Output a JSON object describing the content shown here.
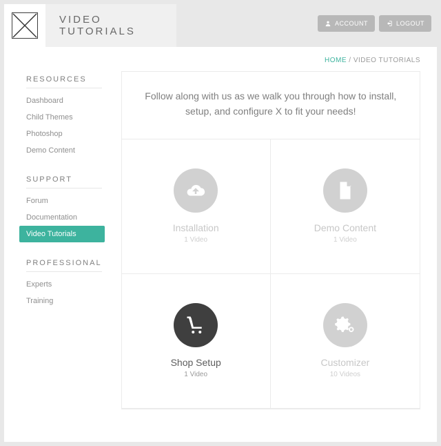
{
  "header": {
    "title": "VIDEO TUTORIALS",
    "account_label": "ACCOUNT",
    "logout_label": "LOGOUT"
  },
  "breadcrumb": {
    "home": "HOME",
    "separator": " / ",
    "current": "VIDEO TUTORIALS"
  },
  "sidebar": {
    "sections": [
      {
        "heading": "RESOURCES",
        "items": [
          {
            "label": "Dashboard"
          },
          {
            "label": "Child Themes"
          },
          {
            "label": "Photoshop"
          },
          {
            "label": "Demo Content"
          }
        ]
      },
      {
        "heading": "SUPPORT",
        "items": [
          {
            "label": "Forum"
          },
          {
            "label": "Documentation"
          },
          {
            "label": "Video Tutorials",
            "active": true
          }
        ]
      },
      {
        "heading": "PROFESSIONAL",
        "items": [
          {
            "label": "Experts"
          },
          {
            "label": "Training"
          }
        ]
      }
    ]
  },
  "main": {
    "intro": "Follow along with us as we walk you through how to install, setup, and configure X to fit your needs!",
    "tiles": [
      {
        "title": "Installation",
        "count": "1 Video",
        "icon": "cloud-upload",
        "emphasis": "muted"
      },
      {
        "title": "Demo Content",
        "count": "1 Video",
        "icon": "file",
        "emphasis": "muted"
      },
      {
        "title": "Shop Setup",
        "count": "1 Video",
        "icon": "cart",
        "emphasis": "dark"
      },
      {
        "title": "Customizer",
        "count": "10 Videos",
        "icon": "gears",
        "emphasis": "muted"
      }
    ]
  }
}
